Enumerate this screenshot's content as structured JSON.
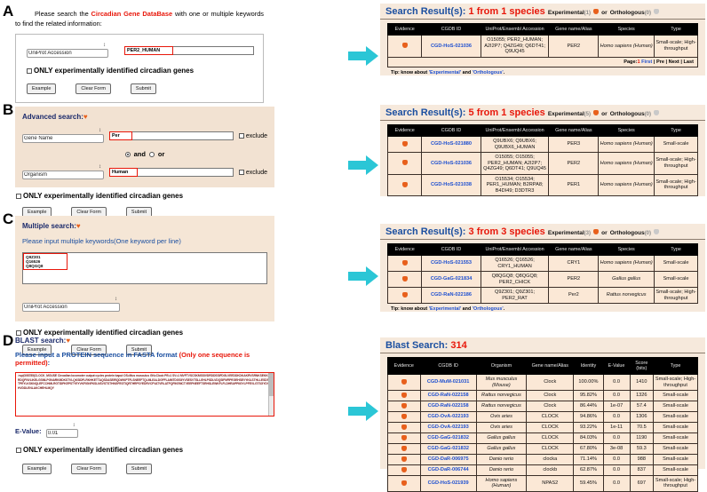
{
  "colors": {
    "accent_blue": "#1b4fa0",
    "red": "#e8170a",
    "arrow": "#2bc6d6",
    "orange": "#e8601c",
    "panel_bg": "#f6e9dc"
  },
  "panels": {
    "a": "A",
    "b": "B",
    "c": "C",
    "d": "D"
  },
  "common": {
    "only_exp_label": "ONLY experimentally identified circadian genes",
    "example": "Example",
    "clear": "Clear Form",
    "submit": "Submit",
    "exclude": "exclude",
    "evidence": "Evidence",
    "cgdb_id": "CGDB ID",
    "accession": "UniProt/Ensembl Accession",
    "gene_name": "Gene name/Alias",
    "species": "Species",
    "type": "Type",
    "tip_prefix": "Tip: know about ",
    "tip_exp": "'Experimental'",
    "tip_and": " and ",
    "tip_orth": "'Orthologous'",
    "tip_end": ".",
    "exp_label": "Experimental",
    "or_label": "or",
    "orth_label": "Orthologous",
    "result_prefix": "Search Result(s):"
  },
  "panelA": {
    "intro_1": "Please search the ",
    "intro_red1": "C",
    "intro_r1": "ircadian ",
    "intro_red2": "G",
    "intro_r2": "ene ",
    "intro_red3": "D",
    "intro_r3": "ata",
    "intro_red4": "B",
    "intro_r4": "ase",
    "intro_2": " with one or multiple keywords to find the related information:",
    "select_value": "UniProt Accession",
    "input_value": "PER2_HUMAN",
    "result": {
      "count_text": "1 from 1 species",
      "exp_count": "(1)",
      "orth_count": "(0)",
      "rows": [
        {
          "cgdb": "CGD-HoS-021036",
          "acc": "O15055; PER2_HUMAN; A2I2P7; Q4ZG49; Q6DT41; Q9UQ45",
          "gene": "PER2",
          "species": "Homo sapiens (Human)",
          "type": "Small-scale; High-throughput"
        }
      ],
      "page_label": "Page:",
      "page_num": "1",
      "first": "First",
      "pre": "Pre",
      "next": "Next",
      "last": "Last"
    }
  },
  "panelB": {
    "title": "Advanced search:",
    "select1": "Gene Name",
    "input1": "Per",
    "and_label": "and",
    "or_label": "or",
    "select2": "Organism",
    "input2": "Human",
    "result": {
      "count_text": "5 from 1 species",
      "exp_count": "(5)",
      "orth_count": "(0)",
      "rows": [
        {
          "cgdb": "CGD-HoS-021880",
          "acc": "Q9UBX6; Q9UBX6; Q9UBX6_HUMAN",
          "gene": "PER3",
          "species": "Homo sapiens (Human)",
          "type": "Small-scale"
        },
        {
          "cgdb": "CGD-HoS-021036",
          "acc": "O15055; O15055; PER2_HUMAN; A2I2P7; Q4ZG49; Q6DT41; Q9UQ45",
          "gene": "PER2",
          "species": "Homo sapiens (Human)",
          "type": "Small-scale; High-throughput"
        },
        {
          "cgdb": "CGD-HoS-021038",
          "acc": "O15534; O15534; PER1_HUMAN; B2RPA8; B4DI49; D3DTR3",
          "gene": "PER1",
          "species": "Homo sapiens (Human)",
          "type": "Small-scale; High-throughput"
        }
      ]
    }
  },
  "panelC": {
    "title": "Multiple search:",
    "subtitle": "Please input multiple keywords(One keyword per line)",
    "keywords": "Q9Z301\nQ16526\nQ8QGQ8",
    "select_value": "UniProt Accession",
    "result": {
      "count_text": "3 from 3 species",
      "exp_count": "(3)",
      "orth_count": "(0)",
      "rows": [
        {
          "cgdb": "CGD-HoS-021553",
          "acc": "Q16526; Q16526; CRY1_HUMAN",
          "gene": "CRY1",
          "species": "Homo sapiens (Human)",
          "type": "Small-scale"
        },
        {
          "cgdb": "CGD-GaG-021834",
          "acc": "Q8QGQ8; Q8QGQ8; PER2_CHICK",
          "gene": "PER2",
          "species": "Gallus gallus",
          "type": "Small-scale"
        },
        {
          "cgdb": "CGD-RaN-022186",
          "acc": "Q9Z301; Q9Z301; PER2_RAT",
          "gene": "Per2",
          "species": "Rattus norvegicus",
          "type": "Small-scale; High-throughput"
        }
      ]
    }
  },
  "panelD": {
    "title": "BLAST search:",
    "subtitle_1": "Please input a PROTEIN sequence in FASTA format ",
    "subtitle_red": "(Only one sequence is permitted)",
    "subtitle_2": ":",
    "sequence": ">sp|O08785|CLOCK_MOUSE Circadian locomoter output cycles protein kaput OS=Mus musculus GN=Clock PE=1 SV=1 MVFTVSCSKMSSIVDRDDSSIFDGLVEEDDKDKAKRVSRNKSEKKRRDQFNVLIKELGSMLPGNARKMDKSTVLQKSIDFLRKHKETTAQSDASEIRQDWKPTFLSNEEFTQLMLEALDGFFLAIMTDGSIIYVSESVTSLLEHLPSDLVDQSIFNFIPEGEHSEVYKILSTHLLESDSLTPEYLKSKNQLEFCCHMLRGTIDPKEPSTYEYVKFIGNFKSLNSVSTSTHNGFEGTIQRTHRPSYEDRVCFVATVRLATPQFIKEMCTVEEPNEEFTSRHSLEWKFLFLDHRAPPIIGYLPFEVLGTSGYDYYHVDDLENLAKCHEHLMQY",
    "evalue_label": "E-Value:",
    "evalue": "0.01",
    "result": {
      "title": "Blast Search:",
      "count": "314",
      "headers": {
        "evidence": "Evidence",
        "cgdb": "CGDB ID",
        "organism": "Organism",
        "gene": "Gene name/Alias",
        "identity": "Identity",
        "evalue": "E-Value",
        "score": "Score (bits)",
        "type": "Type"
      },
      "rows": [
        {
          "cgdb": "CGD-MuM-021031",
          "org": "Mus musculus (Mouse)",
          "gene": "Clock",
          "identity": "100.00%",
          "evalue": "0.0",
          "score": "1410",
          "type": "Small-scale; High-throughput"
        },
        {
          "cgdb": "CGD-RaN-022158",
          "org": "Rattus norvegicus",
          "gene": "Clock",
          "identity": "95.82%",
          "evalue": "0.0",
          "score": "1326",
          "type": "Small-scale"
        },
        {
          "cgdb": "CGD-RaN-022158",
          "org": "Rattus norvegicus",
          "gene": "Clock",
          "identity": "86.44%",
          "evalue": "1e-07",
          "score": "57.4",
          "type": "Small-scale"
        },
        {
          "cgdb": "CGD-OvA-022193",
          "org": "Ovis aries",
          "gene": "CLOCK",
          "identity": "94.86%",
          "evalue": "0.0",
          "score": "1306",
          "type": "Small-scale"
        },
        {
          "cgdb": "CGD-OvA-022193",
          "org": "Ovis aries",
          "gene": "CLOCK",
          "identity": "93.22%",
          "evalue": "1e-11",
          "score": "70.5",
          "type": "Small-scale"
        },
        {
          "cgdb": "CGD-GaG-021832",
          "org": "Gallus gallus",
          "gene": "CLOCK",
          "identity": "84.03%",
          "evalue": "0.0",
          "score": "1190",
          "type": "Small-scale"
        },
        {
          "cgdb": "CGD-GaG-021832",
          "org": "Gallus gallus",
          "gene": "CLOCK",
          "identity": "67.80%",
          "evalue": "3e-08",
          "score": "59.3",
          "type": "Small-scale"
        },
        {
          "cgdb": "CGD-DaR-006975",
          "org": "Danio rerio",
          "gene": "clocka",
          "identity": "71.14%",
          "evalue": "0.0",
          "score": "988",
          "type": "Small-scale"
        },
        {
          "cgdb": "CGD-DaR-006744",
          "org": "Danio rerio",
          "gene": "clockb",
          "identity": "62.87%",
          "evalue": "0.0",
          "score": "837",
          "type": "Small-scale"
        },
        {
          "cgdb": "CGD-HoS-021939",
          "org": "Homo sapiens (Human)",
          "gene": "NPAS2",
          "identity": "59.45%",
          "evalue": "0.0",
          "score": "697",
          "type": "Small-scale; High-throughput"
        }
      ]
    }
  }
}
